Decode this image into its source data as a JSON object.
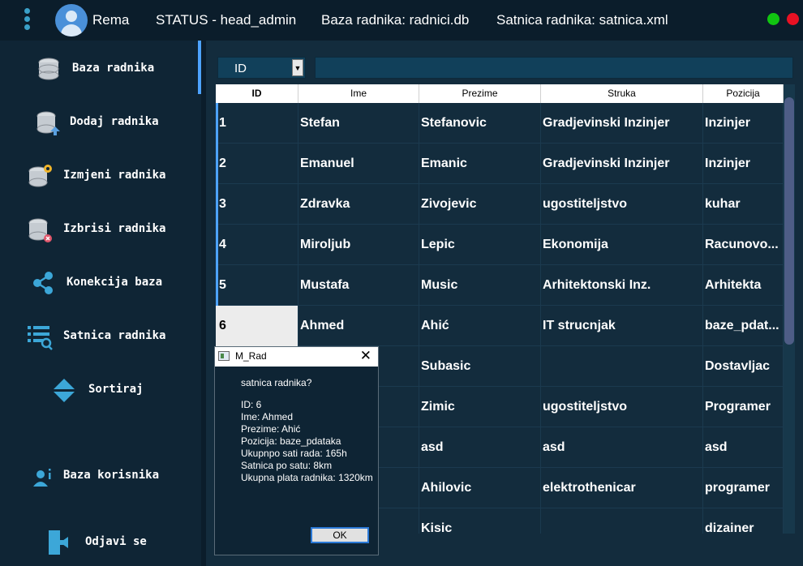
{
  "topbar": {
    "user_name": "Rema",
    "status": "STATUS - head_admin",
    "baza": "Baza radnika: radnici.db",
    "satnica": "Satnica radnika: satnica.xml",
    "colors": {
      "green": "#11c511",
      "red": "#e81123"
    }
  },
  "sidebar": {
    "items": [
      {
        "label": "Baza radnika",
        "icon": "database-icon"
      },
      {
        "label": "Dodaj radnika",
        "icon": "database-add-icon"
      },
      {
        "label": "Izmjeni radnika",
        "icon": "database-edit-icon"
      },
      {
        "label": "Izbrisi radnika",
        "icon": "database-delete-icon"
      },
      {
        "label": "Konekcija baza",
        "icon": "share-icon"
      },
      {
        "label": "Satnica radnika",
        "icon": "list-search-icon"
      },
      {
        "label": "Sortiraj",
        "icon": "sort-icon"
      },
      {
        "label": "Baza korisnika",
        "icon": "users-icon"
      },
      {
        "label": "Odjavi se",
        "icon": "logout-icon"
      }
    ]
  },
  "search": {
    "field_value": "ID",
    "query": ""
  },
  "table": {
    "headers": [
      "ID",
      "Ime",
      "Prezime",
      "Struka",
      "Pozicija"
    ],
    "rows": [
      [
        "1",
        "Stefan",
        "Stefanovic",
        "Gradjevinski Inzinjer",
        "Inzinjer"
      ],
      [
        "2",
        "Emanuel",
        "Emanic",
        "Gradjevinski Inzinjer",
        "Inzinjer"
      ],
      [
        "3",
        "Zdravka",
        "Zivojevic",
        "ugostiteljstvo",
        "kuhar"
      ],
      [
        "4",
        "Miroljub",
        "Lepic",
        "Ekonomija",
        "Racunovo..."
      ],
      [
        "5",
        "Mustafa",
        "Music",
        "Arhitektonski Inz.",
        "Arhitekta"
      ],
      [
        "6",
        "Ahmed",
        "Ahić",
        "IT strucnjak",
        "baze_pdat..."
      ],
      [
        "",
        "",
        "Subasic",
        "",
        "Dostavljac"
      ],
      [
        "",
        "",
        "Zimic",
        "ugostiteljstvo",
        "Programer"
      ],
      [
        "",
        "",
        "asd",
        "asd",
        "asd"
      ],
      [
        "",
        "",
        "Ahilovic",
        "elektrothenicar",
        "programer"
      ],
      [
        "",
        "",
        "Kisic",
        "",
        "dizainer"
      ]
    ]
  },
  "dialog": {
    "title": "M_Rad",
    "question": "satnica radnika?",
    "lines": [
      "ID: 6",
      "Ime: Ahmed",
      "Prezime: Ahić",
      "Pozicija: baze_pdataka",
      "Ukupnpo sati rada: 165h",
      "Satnica po satu: 8km",
      "Ukupna plata radnika: 1320km"
    ],
    "ok_label": "OK"
  }
}
